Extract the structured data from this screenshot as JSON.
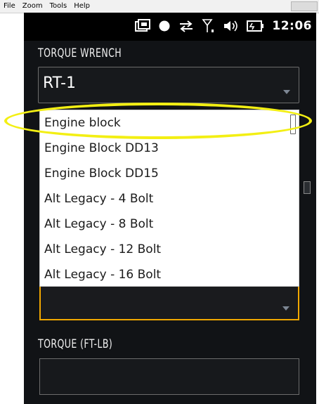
{
  "menubar": {
    "items": [
      "File",
      "Zoom",
      "Tools",
      "Help"
    ]
  },
  "statusbar": {
    "icons": [
      "photo-icon",
      "circle-icon",
      "sync-arrows-icon",
      "signal-icon",
      "volume-icon",
      "battery-icon"
    ],
    "time": "12:06"
  },
  "torque_wrench": {
    "label": "TORQUE WRENCH",
    "value": "RT-1"
  },
  "dropdown": {
    "options": [
      "Engine block",
      "Engine Block DD13",
      "Engine Block DD15",
      "Alt Legacy - 4 Bolt",
      "Alt Legacy - 8 Bolt",
      "Alt Legacy - 12 Bolt",
      "Alt Legacy - 16 Bolt"
    ],
    "highlighted_option": "Engine block"
  },
  "torque": {
    "label": "TORQUE (FT-LB)",
    "value": ""
  },
  "colors": {
    "background": "#111316",
    "accent": "#f2a800",
    "highlight": "#f3ef13"
  }
}
